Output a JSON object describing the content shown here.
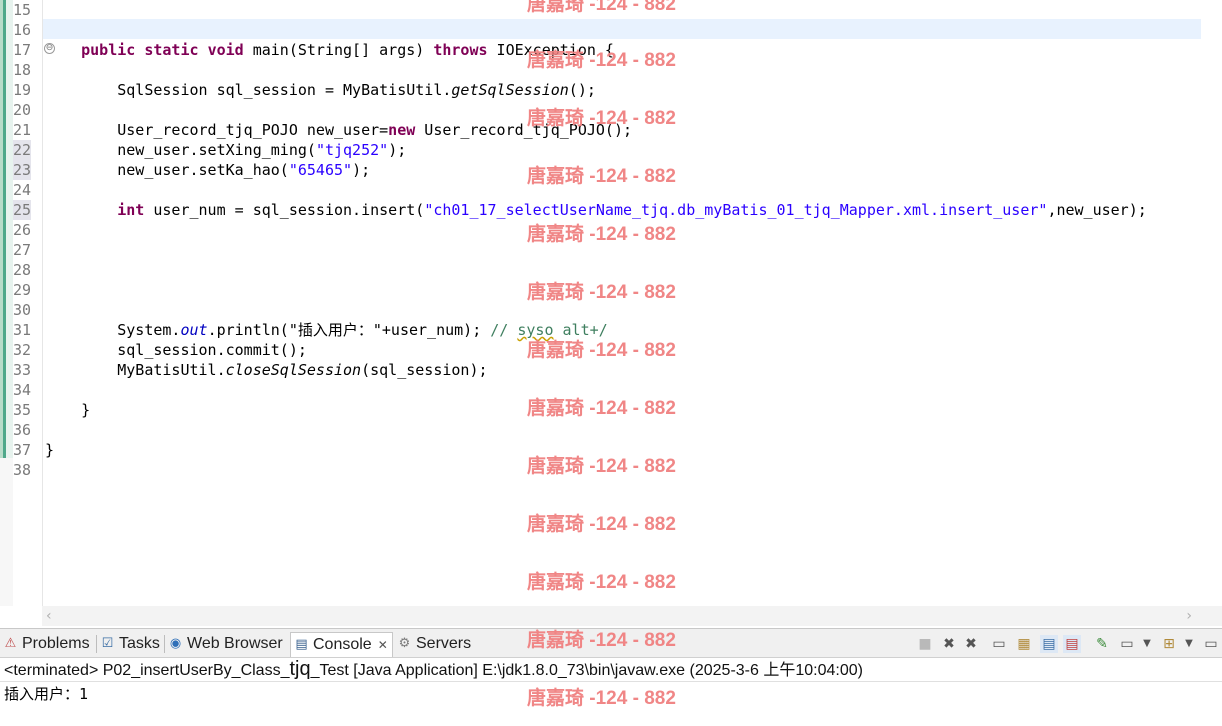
{
  "editor": {
    "line_numbers": [
      "15",
      "16",
      "17",
      "18",
      "19",
      "20",
      "21",
      "22",
      "23",
      "24",
      "25",
      "26",
      "27",
      "28",
      "29",
      "30",
      "31",
      "32",
      "33",
      "34",
      "35",
      "36",
      "37",
      "38"
    ],
    "fold_marker": "⊖",
    "code": {
      "l17": {
        "kw1": "public",
        "kw2": "static",
        "kw3": "void",
        "t1": " main(String[] args) ",
        "kw4": "throws",
        "t2": " IOException {"
      },
      "l19": {
        "t1": "    SqlSession sql_session = MyBatisUtil.",
        "it": "getSqlSession",
        "t2": "();"
      },
      "l21": {
        "t1": "    User_record_tjq_POJO new_user=",
        "kw": "new",
        "t2": " User_record_tjq_POJO();"
      },
      "l22": {
        "t1": "    new_user.setXing_ming(",
        "str": "\"tjq252\"",
        "t2": ");"
      },
      "l23": {
        "t1": "    new_user.setKa_hao(",
        "str": "\"65465\"",
        "t2": ");"
      },
      "l25": {
        "kw": "int",
        "t1": " user_num = sql_session.insert(",
        "str": "\"ch01_17_selectUserName_tjq.db_myBatis_01_tjq_Mapper.xml.insert_user\"",
        "t2": ",new_user);"
      },
      "l31": {
        "t1": "    System.",
        "field": "out",
        "t2": ".println(\"插入用户：\"+user_num); ",
        "cmt1": "// ",
        "squig": "syso",
        "cmt2": " alt+/"
      },
      "l32": {
        "t1": "    sql_session.commit();"
      },
      "l33": {
        "t1": "    MyBatisUtil.",
        "it": "closeSqlSession",
        "t2": "(sql_session);"
      },
      "l35": {
        "t1": "}"
      },
      "l37": {
        "t1": "}"
      }
    }
  },
  "panel": {
    "tabs": [
      {
        "label": "Problems",
        "icon": "problems-icon"
      },
      {
        "label": "Tasks",
        "icon": "tasks-icon"
      },
      {
        "label": "Web Browser",
        "icon": "web-browser-icon"
      },
      {
        "label": "Console",
        "icon": "console-icon",
        "close": "✕"
      },
      {
        "label": "Servers",
        "icon": "servers-icon"
      }
    ],
    "console_status_a": "<terminated> P02_insertUserBy_Class_",
    "console_status_b": "tjq",
    "console_status_c": "_Test [Java Application] E:\\jdk1.8.0_73\\bin\\javaw.exe (2025-3-6 上午10:04:00)",
    "console_output": "插入用户：1"
  },
  "watermark": "唐嘉琦 -124 - 882",
  "colors": {
    "keyword": "#7f0055",
    "string": "#2a00ff",
    "comment": "#3f7f5f",
    "field": "#0000c0",
    "watermark": "#f08080"
  }
}
